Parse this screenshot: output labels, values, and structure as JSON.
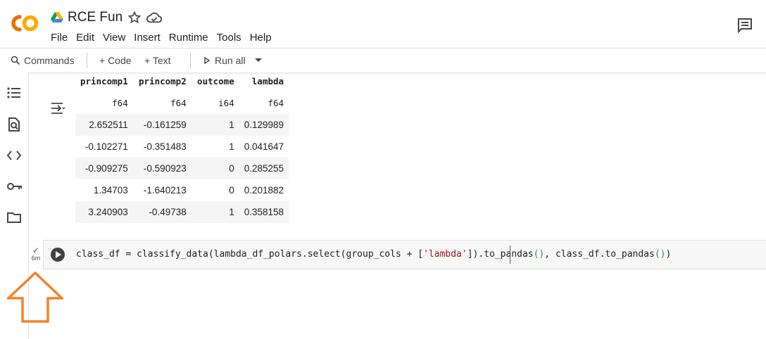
{
  "app": {
    "notebook_title": "RCE Fun",
    "logo_text": "CO",
    "menu": [
      "File",
      "Edit",
      "View",
      "Insert",
      "Runtime",
      "Tools",
      "Help"
    ]
  },
  "toolbar": {
    "commands_label": "Commands",
    "add_code_label": "+ Code",
    "add_text_label": "+ Text",
    "run_all_label": "Run all"
  },
  "icons": {
    "logo": "colab-logo",
    "drive": "google-drive-icon",
    "star": "star-icon",
    "cloud": "cloud-saved-icon",
    "comments": "comment-icon",
    "rail": [
      "table-of-contents-icon",
      "find-replace-icon",
      "code-snippets-icon",
      "secrets-key-icon",
      "files-folder-icon"
    ],
    "output": "output-actions-icon",
    "run": "play-icon",
    "annotation": "orange-up-arrow"
  },
  "output_table": {
    "columns": [
      "princomp1",
      "princomp2",
      "outcome",
      "lambda"
    ],
    "dtypes": [
      "f64",
      "f64",
      "i64",
      "f64"
    ],
    "rows": [
      [
        "2.652511",
        "-0.161259",
        "1",
        "0.129989"
      ],
      [
        "-0.102271",
        "-0.351483",
        "1",
        "0.041647"
      ],
      [
        "-0.909275",
        "-0.590923",
        "0",
        "0.285255"
      ],
      [
        "1.34703",
        "-1.640213",
        "0",
        "0.201882"
      ],
      [
        "3.240903",
        "-0.49738",
        "1",
        "0.358158"
      ]
    ]
  },
  "cell": {
    "status_check": "✓",
    "exec_time": "6m",
    "code": {
      "part1": "class_df = classify_data(lambda_df_polars.select(group_cols + [",
      "string": "'lambda'",
      "part2": "]).to_pandas",
      "paren1": "()",
      "part3": ", class_df.to_pandas",
      "paren2": "()",
      "part4": ")"
    }
  },
  "colors": {
    "logo_orange": "#f9ab00",
    "logo_amber": "#e8710a",
    "annotation_arrow": "#f5822a",
    "check_green": "#188038"
  }
}
